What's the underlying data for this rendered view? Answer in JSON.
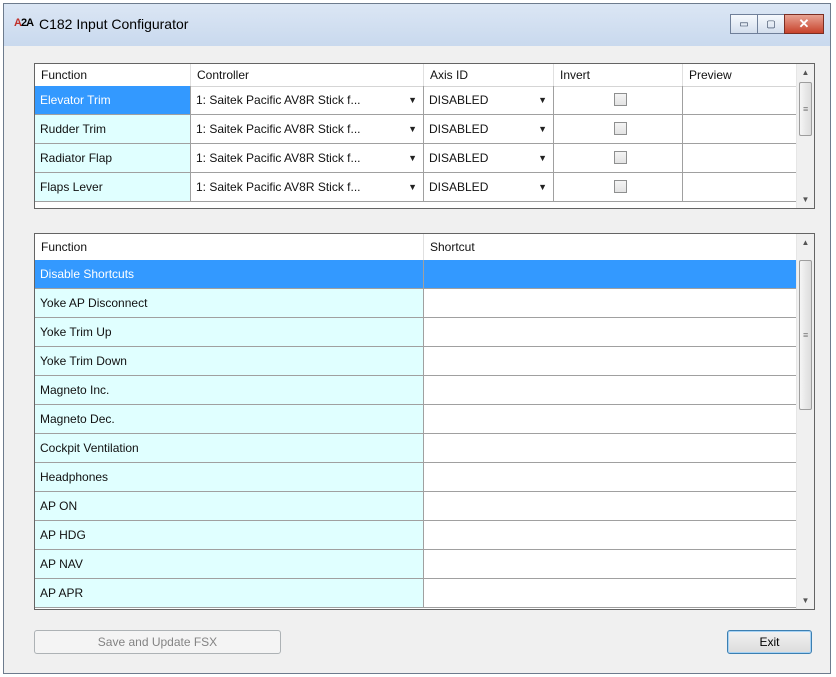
{
  "window": {
    "title": "C182 Input Configurator",
    "icon_label": "A2A",
    "controls": {
      "minimize": "▭",
      "maximize": "▢",
      "close": "✕"
    }
  },
  "axes_grid": {
    "headers": [
      "Function",
      "Controller",
      "Axis ID",
      "Invert",
      "Preview"
    ],
    "rows": [
      {
        "function": "Elevator Trim",
        "controller": "1: Saitek Pacific AV8R Stick f...",
        "axis_id": "DISABLED",
        "invert": false,
        "selected": true
      },
      {
        "function": "Rudder Trim",
        "controller": "1: Saitek Pacific AV8R Stick f...",
        "axis_id": "DISABLED",
        "invert": false,
        "selected": false
      },
      {
        "function": "Radiator Flap",
        "controller": "1: Saitek Pacific AV8R Stick f...",
        "axis_id": "DISABLED",
        "invert": false,
        "selected": false
      },
      {
        "function": "Flaps Lever",
        "controller": "1: Saitek Pacific AV8R Stick f...",
        "axis_id": "DISABLED",
        "invert": false,
        "selected": false
      }
    ]
  },
  "shortcuts_grid": {
    "headers": [
      "Function",
      "Shortcut"
    ],
    "rows": [
      {
        "function": "Disable Shortcuts",
        "shortcut": "",
        "selected": true
      },
      {
        "function": "Yoke AP Disconnect",
        "shortcut": ""
      },
      {
        "function": "Yoke Trim Up",
        "shortcut": ""
      },
      {
        "function": "Yoke Trim Down",
        "shortcut": ""
      },
      {
        "function": "Magneto Inc.",
        "shortcut": ""
      },
      {
        "function": "Magneto Dec.",
        "shortcut": ""
      },
      {
        "function": "Cockpit Ventilation",
        "shortcut": ""
      },
      {
        "function": "Headphones",
        "shortcut": ""
      },
      {
        "function": "AP ON",
        "shortcut": ""
      },
      {
        "function": "AP HDG",
        "shortcut": ""
      },
      {
        "function": "AP NAV",
        "shortcut": ""
      },
      {
        "function": "AP APR",
        "shortcut": ""
      }
    ]
  },
  "buttons": {
    "save": "Save and Update FSX",
    "exit": "Exit"
  },
  "colors": {
    "function_cell_bg": "#e0ffff",
    "selection": "#3399ff"
  }
}
